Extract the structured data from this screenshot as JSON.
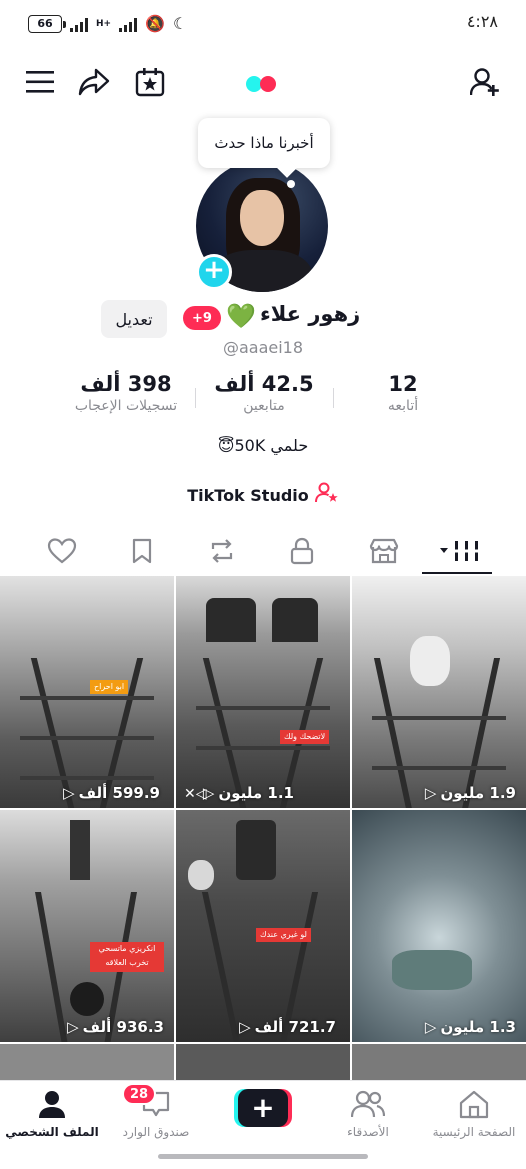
{
  "status_bar": {
    "battery": "66",
    "network": "H+",
    "time": "٤:٢٨"
  },
  "tooltip": {
    "text": "أخبرنا ماذا حدث"
  },
  "profile": {
    "display_name": "زهور علاء",
    "notification_badge": "+9",
    "username": "@aaaei18",
    "edit_button": "تعديل",
    "stats": [
      {
        "value": "398 ألف",
        "label": "تسجيلات الإعجاب"
      },
      {
        "value": "42.5 ألف",
        "label": "متابعين"
      },
      {
        "value": "12",
        "label": "أتابعه"
      }
    ],
    "bio": "حلمي 50K😇",
    "studio_link": "TikTok Studio"
  },
  "videos": [
    {
      "views": "599.9 ألف",
      "caption": "ابو احراح"
    },
    {
      "views": "1.1 مليون",
      "caption": "لاتضحك ولك"
    },
    {
      "views": "1.9 مليون",
      "caption": ""
    },
    {
      "views": "936.3 ألف",
      "caption": "انكريزي ماتسحي تخرب العلاقه"
    },
    {
      "views": "721.7 ألف",
      "caption": "لو غيري عندك"
    },
    {
      "views": "1.3 مليون",
      "caption": ""
    }
  ],
  "bottom_nav": {
    "profile": "الملف الشخصي",
    "inbox": "صندوق الوارد",
    "inbox_badge": "28",
    "friends": "الأصدقاء",
    "home": "الصفحة الرئيسية"
  },
  "colors": {
    "brand_red": "#fe2c55",
    "brand_cyan": "#25f4ee",
    "avatar_plus": "#20d5ec"
  }
}
